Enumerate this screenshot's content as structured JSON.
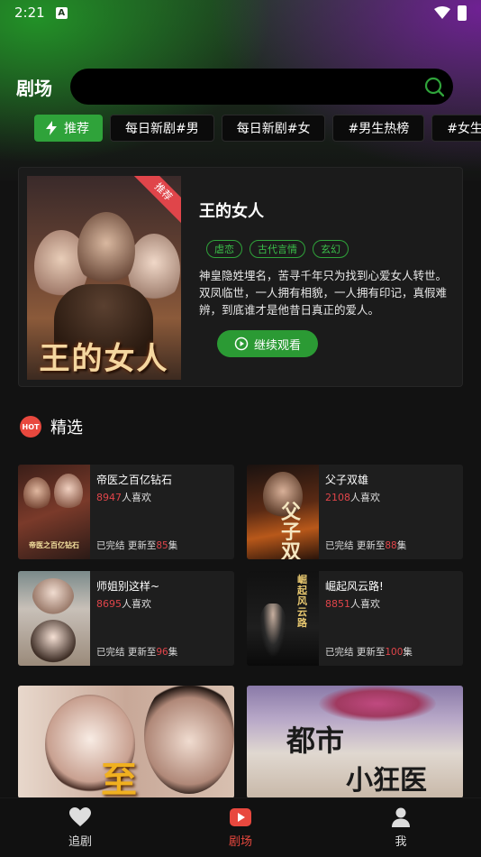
{
  "status_bar": {
    "time": "2:21",
    "notif_badge": "A"
  },
  "header": {
    "title": "剧场",
    "search_placeholder": ""
  },
  "tags": [
    {
      "label": "推荐",
      "active": true
    },
    {
      "label": "每日新剧#男",
      "active": false
    },
    {
      "label": "每日新剧#女",
      "active": false
    },
    {
      "label": "#男生热榜",
      "active": false
    },
    {
      "label": "#女生",
      "active": false
    }
  ],
  "featured": {
    "ribbon": "推荐",
    "poster_text": "王的女人",
    "title": "王的女人",
    "genres": [
      "虐恋",
      "古代言情",
      "玄幻"
    ],
    "description": "神皇隐姓埋名，苦寻千年只为找到心爱女人转世。双凤临世，一人拥有相貌，一人拥有印记，真假难辨，到底谁才是他昔日真正的爱人。",
    "play_label": "继续观看"
  },
  "section": {
    "badge": "HOT",
    "title": "精选"
  },
  "cards": [
    {
      "title": "帝医之百亿钻石",
      "likes": "8947",
      "likes_suffix": "人喜欢",
      "status": "已完结 更新至",
      "episodes": "85",
      "ep_suffix": "集",
      "poster_text": "帝医之百亿钻石"
    },
    {
      "title": "父子双雄",
      "likes": "2108",
      "likes_suffix": "人喜欢",
      "status": "已完结 更新至",
      "episodes": "88",
      "ep_suffix": "集",
      "poster_text": "父子双雄"
    },
    {
      "title": "师姐别这样~",
      "likes": "8695",
      "likes_suffix": "人喜欢",
      "status": "已完结 更新至",
      "episodes": "96",
      "ep_suffix": "集",
      "poster_text": ""
    },
    {
      "title": "崛起风云路!",
      "likes": "8851",
      "likes_suffix": "人喜欢",
      "status": "已完结 更新至",
      "episodes": "100",
      "ep_suffix": "集",
      "poster_text": "崛起风云路"
    }
  ],
  "big_cards": [
    {
      "poster_text": "至"
    },
    {
      "poster_text_1": "都市",
      "poster_text_2": "小狂医"
    }
  ],
  "bottom_nav": [
    {
      "label": "追剧",
      "icon": "heart-icon",
      "active": false
    },
    {
      "label": "剧场",
      "icon": "play-icon",
      "active": true
    },
    {
      "label": "我",
      "icon": "person-icon",
      "active": false
    }
  ],
  "colors": {
    "accent_green": "#2fa33a",
    "accent_red": "#e8483e"
  }
}
